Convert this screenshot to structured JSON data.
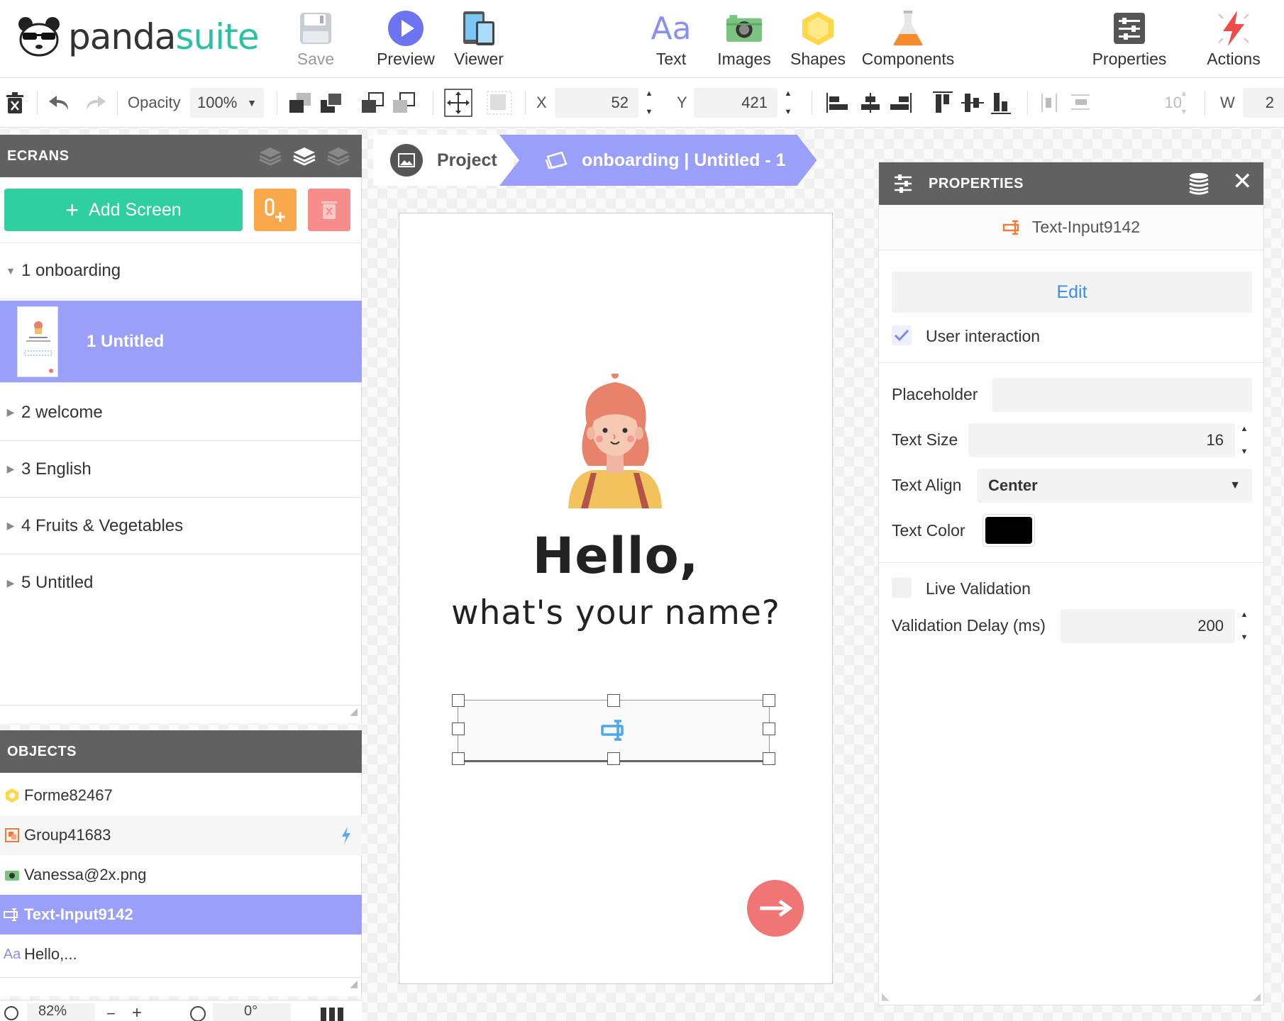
{
  "app": {
    "logo_part1": "panda",
    "logo_part2": "suite",
    "accent": "#9aa0fa",
    "brand": "#2bc1a4"
  },
  "toolbar": {
    "save": "Save",
    "preview": "Preview",
    "viewer": "Viewer",
    "text": "Text",
    "images": "Images",
    "shapes": "Shapes",
    "components": "Components",
    "properties": "Properties",
    "actions": "Actions"
  },
  "toolbar2": {
    "opacity_label": "Opacity",
    "opacity_value": "100%",
    "x_label": "X",
    "x_value": "52",
    "y_label": "Y",
    "y_value": "421",
    "spacing_value": "10",
    "w_label": "W",
    "w_value": "2"
  },
  "ecrans": {
    "title": "ECRANS",
    "add_screen": "Add Screen",
    "items": [
      {
        "label": "1 onboarding"
      },
      {
        "label": "1 Untitled"
      },
      {
        "label": "2 welcome"
      },
      {
        "label": "3 English"
      },
      {
        "label": "4 Fruits & Vegetables"
      },
      {
        "label": "5 Untitled"
      }
    ]
  },
  "objects": {
    "title": "OBJECTS",
    "items": [
      {
        "label": "Forme82467",
        "icon": "hexagon-icon"
      },
      {
        "label": "Group41683",
        "icon": "group-icon"
      },
      {
        "label": "Vanessa@2x.png",
        "icon": "camera-icon"
      },
      {
        "label": "Text-Input9142",
        "icon": "text-input-icon"
      },
      {
        "label": "Hello,...",
        "icon": "text-icon"
      }
    ]
  },
  "breadcrumb": {
    "project": "Project",
    "current": "onboarding | Untitled - 1"
  },
  "canvas": {
    "greeting": "Hello,",
    "question": "what's your name?"
  },
  "properties": {
    "title": "PROPERTIES",
    "object_name": "Text-Input9142",
    "edit": "Edit",
    "user_interaction": "User interaction",
    "placeholder_label": "Placeholder",
    "placeholder_value": "",
    "text_size_label": "Text Size",
    "text_size_value": "16",
    "text_align_label": "Text Align",
    "text_align_value": "Center",
    "text_color_label": "Text Color",
    "text_color_value": "#000000",
    "live_validation": "Live Validation",
    "validation_delay_label": "Validation Delay (ms)",
    "validation_delay_value": "200"
  },
  "status": {
    "zoom": "82%",
    "rotation": "0°"
  }
}
